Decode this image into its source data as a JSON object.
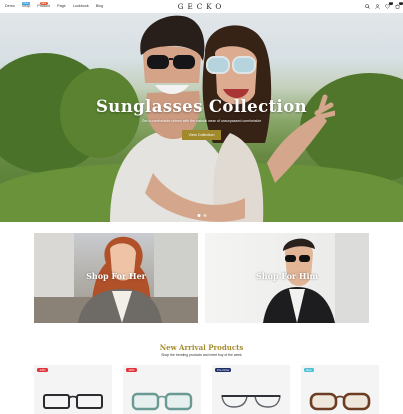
{
  "header": {
    "logo": "GECKO",
    "nav": [
      {
        "label": "Demo"
      },
      {
        "label": "Shop",
        "badge": "New",
        "badge_color": "#3aa0dc"
      },
      {
        "label": "Product",
        "badge": "Sale",
        "badge_color": "#e25c36"
      },
      {
        "label": "Page"
      },
      {
        "label": "Lookbook"
      },
      {
        "label": "Blog"
      }
    ],
    "icons": [
      "search-icon",
      "user-icon",
      "heart-icon",
      "cart-icon"
    ],
    "wishlist_count": "0",
    "cart_count": "0"
  },
  "hero": {
    "title": "Sunglasses Collection",
    "subtitle": "Get a comfortable unisex with the natural wear of unsurpassed comfortable",
    "button_label": "View Collection",
    "accent_color": "#a08a2c",
    "slides": 2,
    "active_slide": 1
  },
  "categories": [
    {
      "label": "Shop For Her"
    },
    {
      "label": "Shop For Him"
    }
  ],
  "new_arrivals": {
    "title": "New Arrival Products",
    "subtitle": "Shop the trending products and meet buy of the week",
    "title_color": "#a48c2e",
    "products": [
      {
        "badge": "-24%",
        "badge_color": "#e2323a",
        "frame_color": "#2a2c30"
      },
      {
        "badge": "-30%",
        "badge_color": "#e2323a",
        "frame_color": "#6a9a94"
      },
      {
        "badge": "Pre-Order",
        "badge_color": "#1e2f6b",
        "frame_color": "#5d6168"
      },
      {
        "badge": "New",
        "badge_color": "#4ec2d4",
        "frame_color": "#6b3d22"
      }
    ]
  }
}
